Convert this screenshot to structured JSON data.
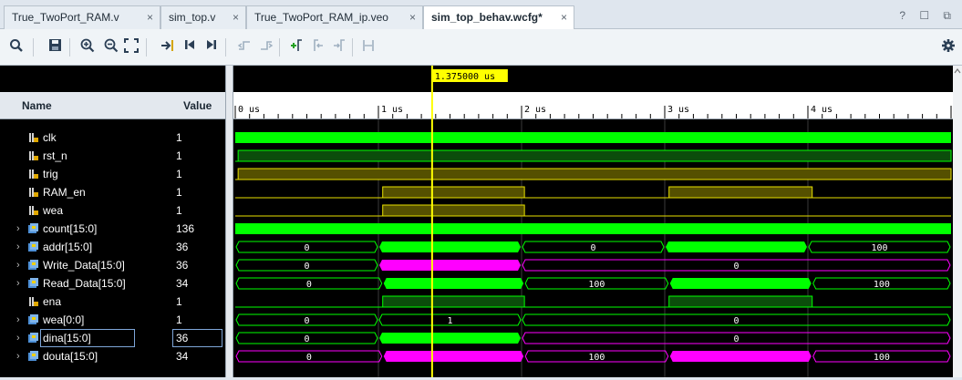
{
  "tabs": [
    {
      "label": "True_TwoPort_RAM.v",
      "active": false
    },
    {
      "label": "sim_top.v",
      "active": false
    },
    {
      "label": "True_TwoPort_RAM_ip.veo",
      "active": false
    },
    {
      "label": "sim_top_behav.wcfg*",
      "active": true
    }
  ],
  "tab_close_glyph": "×",
  "window_controls": "? ☐ ⧉",
  "toolbar_icons": [
    "search-icon",
    "save-icon",
    "zoom-in-icon",
    "zoom-out-icon",
    "zoom-fit-icon",
    "go-to-cursor-icon",
    "go-to-time-zero-icon",
    "go-to-last-time-icon",
    "previous-transition-icon",
    "next-transition-icon",
    "add-marker-icon",
    "previous-marker-icon",
    "next-marker-icon",
    "swap-cursors-icon",
    "settings-gear-icon"
  ],
  "headers": {
    "name": "Name",
    "value": "Value"
  },
  "cursor": {
    "time_label": "1.375000 us",
    "time_us": 1.375
  },
  "time_axis": {
    "unit": "us",
    "labels": [
      "0 us",
      "1 us",
      "2 us",
      "3 us",
      "4 us"
    ],
    "ticks_us": [
      0,
      1,
      2,
      3,
      4
    ],
    "range_us": [
      0,
      5
    ]
  },
  "colors": {
    "bus_green": "#00ff00",
    "magenta": "#ff00ff",
    "low_green": "#00a000",
    "bit_fill": "#0b4d0b",
    "yellow_fill": "#555000",
    "yellow_line": "#e8e000",
    "cursor": "#ffff00",
    "grid": "#3a3a3a"
  },
  "signals": [
    {
      "name": "clk",
      "value": "1",
      "type": "bit",
      "expandable": false
    },
    {
      "name": "rst_n",
      "value": "1",
      "type": "bit",
      "expandable": false
    },
    {
      "name": "trig",
      "value": "1",
      "type": "bit",
      "expandable": false
    },
    {
      "name": "RAM_en",
      "value": "1",
      "type": "bit",
      "expandable": false
    },
    {
      "name": "wea",
      "value": "1",
      "type": "bit",
      "expandable": false
    },
    {
      "name": "count[15:0]",
      "value": "136",
      "type": "bus",
      "expandable": true
    },
    {
      "name": "addr[15:0]",
      "value": "36",
      "type": "bus",
      "expandable": true
    },
    {
      "name": "Write_Data[15:0]",
      "value": "36",
      "type": "bus",
      "expandable": true
    },
    {
      "name": "Read_Data[15:0]",
      "value": "34",
      "type": "bus",
      "expandable": true
    },
    {
      "name": "ena",
      "value": "1",
      "type": "bit",
      "expandable": false
    },
    {
      "name": "wea[0:0]",
      "value": "1",
      "type": "bus",
      "expandable": true
    },
    {
      "name": "dina[15:0]",
      "value": "36",
      "type": "bus",
      "expandable": true,
      "selected": true
    },
    {
      "name": "douta[15:0]",
      "value": "34",
      "type": "bus",
      "expandable": true
    }
  ],
  "waves": [
    {
      "kind": "clock",
      "color": "green"
    },
    {
      "kind": "bit",
      "segs": [
        [
          0,
          0.02,
          0
        ],
        [
          0.02,
          5,
          1
        ]
      ],
      "color": "green"
    },
    {
      "kind": "bit",
      "segs": [
        [
          0,
          0.02,
          0
        ],
        [
          0.02,
          5,
          1
        ]
      ],
      "color": "yellow"
    },
    {
      "kind": "bit",
      "segs": [
        [
          0,
          1.03,
          0
        ],
        [
          1.03,
          2.02,
          1
        ],
        [
          2.02,
          3.03,
          0
        ],
        [
          3.03,
          4.03,
          1
        ],
        [
          4.03,
          5,
          0
        ]
      ],
      "color": "yellow"
    },
    {
      "kind": "bit",
      "segs": [
        [
          0,
          1.03,
          0
        ],
        [
          1.03,
          2.02,
          1
        ],
        [
          2.02,
          5,
          0
        ]
      ],
      "color": "yellow"
    },
    {
      "kind": "busfill",
      "color": "green"
    },
    {
      "kind": "bus",
      "segs": [
        [
          0,
          1.0,
          "0",
          "o"
        ],
        [
          1.0,
          2.0,
          "",
          "g"
        ],
        [
          2.0,
          3.0,
          "0",
          "o"
        ],
        [
          3.0,
          4.0,
          "",
          "g"
        ],
        [
          4.0,
          5,
          "100",
          "o"
        ]
      ]
    },
    {
      "kind": "bus",
      "segs": [
        [
          0,
          1.0,
          "0",
          "o"
        ],
        [
          1.0,
          2.0,
          "",
          "m"
        ],
        [
          2.0,
          5,
          "0",
          "mo"
        ]
      ]
    },
    {
      "kind": "bus",
      "segs": [
        [
          0,
          1.03,
          "0",
          "o"
        ],
        [
          1.03,
          2.02,
          "",
          "g"
        ],
        [
          2.02,
          3.03,
          "100",
          "o"
        ],
        [
          3.03,
          4.03,
          "",
          "g"
        ],
        [
          4.03,
          5,
          "100",
          "o"
        ]
      ]
    },
    {
      "kind": "bit",
      "segs": [
        [
          0,
          1.03,
          0
        ],
        [
          1.03,
          2.02,
          1
        ],
        [
          2.02,
          3.03,
          0
        ],
        [
          3.03,
          4.03,
          1
        ],
        [
          4.03,
          5,
          0
        ]
      ],
      "color": "green"
    },
    {
      "kind": "bus",
      "segs": [
        [
          0,
          1.0,
          "0",
          "o"
        ],
        [
          1.0,
          2.0,
          "1",
          "o"
        ],
        [
          2.0,
          5,
          "0",
          "o"
        ]
      ]
    },
    {
      "kind": "bus",
      "segs": [
        [
          0,
          1.0,
          "0",
          "o"
        ],
        [
          1.0,
          2.0,
          "",
          "g"
        ],
        [
          2.0,
          5,
          "0",
          "mo"
        ]
      ]
    },
    {
      "kind": "bus",
      "segs": [
        [
          0,
          1.03,
          "0",
          "mo"
        ],
        [
          1.03,
          2.02,
          "",
          "m"
        ],
        [
          2.02,
          3.03,
          "100",
          "mo"
        ],
        [
          3.03,
          4.03,
          "",
          "m"
        ],
        [
          4.03,
          5,
          "100",
          "mo"
        ]
      ]
    }
  ]
}
